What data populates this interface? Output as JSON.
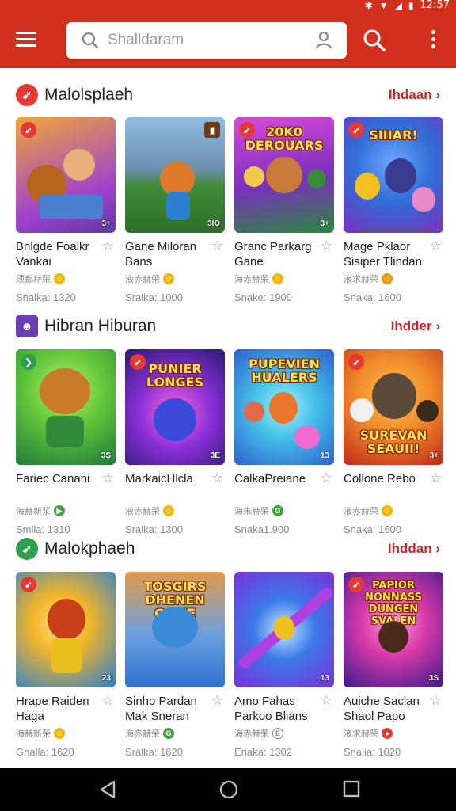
{
  "status": {
    "time": "12:57"
  },
  "search": {
    "placeholder": "Shalldaram"
  },
  "sections": [
    {
      "title": "Malolsplaeh",
      "more": "Ihdaan",
      "badge_color": "#e53935",
      "cards": [
        {
          "name": "Bnlgde Foalkr Vankai",
          "meta": "须都赫荣",
          "size": "Snalka: 1320",
          "age": "3+",
          "banner": "",
          "bg": [
            "#f0a53a",
            "#5c3b9e"
          ],
          "meta_color": "#f2b705"
        },
        {
          "name": "Gane Miloran Bans",
          "meta": "液赤赫荣",
          "size": "Sralka: 1000",
          "age": "3Ю",
          "banner": "",
          "bg": [
            "#7fb0d8",
            "#3f8a35"
          ],
          "meta_color": "#f2b705"
        },
        {
          "name": "Granc Parkarg Gane",
          "meta": "海赤赫荣",
          "size": "Snake: 1900",
          "age": "3+",
          "banner": "20K0 DEROUARS",
          "bg": [
            "#c93ad8",
            "#2a8a3a"
          ],
          "meta_color": "#f2b705"
        },
        {
          "name": "Mage Pklaor Sisiper Tlindan",
          "meta": "液求赫荣",
          "size": "Snaka: 1600",
          "age": "",
          "banner": "SIIIAR!",
          "bg": [
            "#2f6fd6",
            "#7a2fc0"
          ],
          "meta_color": "#f29b05"
        }
      ]
    },
    {
      "title": "Hibran Hiburan",
      "more": "Ihdder",
      "badge_color": "#6a3fb5",
      "cards": [
        {
          "name": "Fariec Canani",
          "meta": "海赫新浆",
          "size": "Smlla: 1310",
          "age": "3S",
          "banner": "",
          "bg": [
            "#5fc43a",
            "#1f7a3a"
          ],
          "meta_color": "#43a047"
        },
        {
          "name": "MarkaicHlcla",
          "meta": "液赤赫荣",
          "size": "Sralka: 1300",
          "age": "3E",
          "banner": "PUNIER LONGES",
          "bg": [
            "#8a2fd8",
            "#2a1a6e"
          ],
          "meta_color": "#f2b705"
        },
        {
          "name": "CalkaPreiane",
          "meta": "海朱赫荣",
          "size": "Snaka1.900",
          "age": "13",
          "banner": "PUPEVIEN HUALERS",
          "bg": [
            "#45c2e8",
            "#2f5fd0"
          ],
          "meta_color": "#43a047"
        },
        {
          "name": "Collone Rebo",
          "meta": "液赤赫荣",
          "size": "Snaka: 1600",
          "age": "3+",
          "banner": "SUREVAN SEAUII!",
          "bg": [
            "#f08a2a",
            "#c0281a"
          ],
          "meta_color": "#f2b705"
        }
      ]
    },
    {
      "title": "Malokphaeh",
      "more": "Ihddan",
      "badge_color": "#2e9e4f",
      "cards": [
        {
          "name": "Hrape Raiden Haga",
          "meta": "海赫新荣",
          "size": "Gnalla: 1620",
          "age": "23",
          "banner": "",
          "bg": [
            "#f0b52a",
            "#2a7fd0"
          ],
          "meta_color": "#f2b705"
        },
        {
          "name": "Sinho Pardan Mak Sneran",
          "meta": "海赤赫荣",
          "size": "Sralka: 1620",
          "age": "",
          "banner": "TOSGIRS DHENEN GAME",
          "bg": [
            "#e09a4a",
            "#2f6fd0"
          ],
          "meta_color": "#43a047"
        },
        {
          "name": "Amo Fahas Parkoo Blians",
          "meta": "海赤赫荣",
          "size": "Enaka: 1302",
          "age": "13",
          "banner": "",
          "bg": [
            "#3a7ae8",
            "#7a2fd8"
          ],
          "meta_color": "#ffffff"
        },
        {
          "name": "Auiche Saclan Shaol Papo",
          "meta": "液求赫荣",
          "size": "Snalia: 1020",
          "age": "3S",
          "banner": "PAPIOR NONNASS DUNGEN SVALEN",
          "bg": [
            "#d83aa8",
            "#3a1a8e"
          ],
          "meta_color": "#e53935"
        }
      ]
    }
  ]
}
